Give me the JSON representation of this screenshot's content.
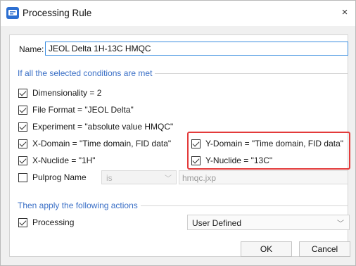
{
  "window": {
    "title": "Processing Rule",
    "close_glyph": "×"
  },
  "name": {
    "label": "Name:",
    "value": "JEOL Delta 1H-13C HMQC"
  },
  "conditions": {
    "header": "If all the selected conditions are met",
    "items": [
      {
        "label": "Dimensionality = 2",
        "checked": true
      },
      {
        "label": "File Format = \"JEOL Delta\"",
        "checked": true
      },
      {
        "label": "Experiment = \"absolute value HMQC\"",
        "checked": true
      },
      {
        "label": "X-Domain = \"Time domain, FID data\"",
        "checked": true
      },
      {
        "label": "X-Nuclide = \"1H\"",
        "checked": true
      },
      {
        "label": "Y-Domain = \"Time domain, FID data\"",
        "checked": true
      },
      {
        "label": "Y-Nuclide = \"13C\"",
        "checked": true
      },
      {
        "label": "Pulprog Name",
        "checked": false
      }
    ],
    "pulprog": {
      "operator": "is",
      "value": "hmqc.jxp"
    }
  },
  "actions": {
    "header": "Then apply the following actions",
    "processing_label": "Processing",
    "processing_checked": true,
    "processing_option": "User Defined"
  },
  "buttons": {
    "ok": "OK",
    "cancel": "Cancel"
  },
  "colors": {
    "accent": "#3a6fc6",
    "highlight": "#e33b3b"
  },
  "icons": {
    "app": "app-icon",
    "close": "close-icon",
    "dropdown": "chevron-down-icon"
  }
}
